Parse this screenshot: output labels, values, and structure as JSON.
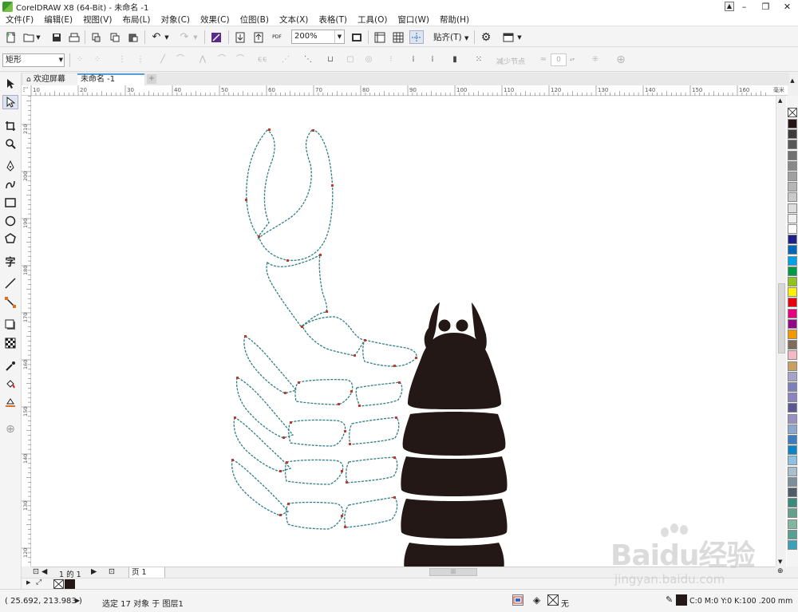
{
  "window": {
    "title": "CorelDRAW X8 (64-Bit) - 未命名 -1",
    "minimize": "–",
    "restore": "❐",
    "close": "✕"
  },
  "menu": [
    "文件(F)",
    "编辑(E)",
    "视图(V)",
    "布局(L)",
    "对象(C)",
    "效果(C)",
    "位图(B)",
    "文本(X)",
    "表格(T)",
    "工具(O)",
    "窗口(W)",
    "帮助(H)"
  ],
  "toolbar": {
    "zoom_value": "200%",
    "snap_label": "贴齐(T)",
    "pdf_label": "PDF"
  },
  "propbar": {
    "shape_type": "矩形",
    "reduce_nodes": "减少节点",
    "smooth_value": "0"
  },
  "tabs": {
    "welcome": "欢迎屏幕",
    "document": "未命名 -1",
    "close_glyph": "×",
    "add_glyph": "+"
  },
  "ruler": {
    "unit": "毫米",
    "top_ticks": [
      "10",
      "20",
      "30",
      "40",
      "50",
      "60",
      "70",
      "80",
      "90",
      "100",
      "110",
      "120",
      "130",
      "140",
      "150",
      "160"
    ],
    "left_ticks": [
      "210",
      "200",
      "190",
      "180",
      "170",
      "160",
      "150",
      "140",
      "130",
      "120"
    ]
  },
  "pagenav": {
    "counter": "1 的 1",
    "page_tab": "页 1"
  },
  "palette_colors": [
    "#231815",
    "#3e3a39",
    "#595757",
    "#727171",
    "#898989",
    "#9fa0a0",
    "#b5b5b6",
    "#c9caca",
    "#dcdddd",
    "#efefef",
    "#ffffff",
    "#1d2088",
    "#0068b7",
    "#00a0e9",
    "#009944",
    "#8fc31f",
    "#fff100",
    "#e60012",
    "#e4007f",
    "#920783",
    "#f39800",
    "#7e6b5a",
    "#f3b9c4",
    "#c9a063",
    "#a5a3c9",
    "#7d7fb9",
    "#8c83c0",
    "#5b5891",
    "#9b90c2",
    "#8ba7cd",
    "#3c7cbf",
    "#0c85c7",
    "#8cc1e6",
    "#a7bfcf",
    "#7b8e9b",
    "#4e5d67",
    "#3a8b7a",
    "#65a08a",
    "#82b79f",
    "#56a091",
    "#3ba1b8"
  ],
  "status": {
    "coords": "( 25.692, 213.983 )",
    "selection": "选定 17 对象 于 图层1",
    "fill_text": "无",
    "outline_text": "C:0 M:0 Y:0 K:100 .200 mm"
  },
  "watermark": {
    "main": "Baidu经验",
    "sub": "jingyan.baidu.com"
  }
}
